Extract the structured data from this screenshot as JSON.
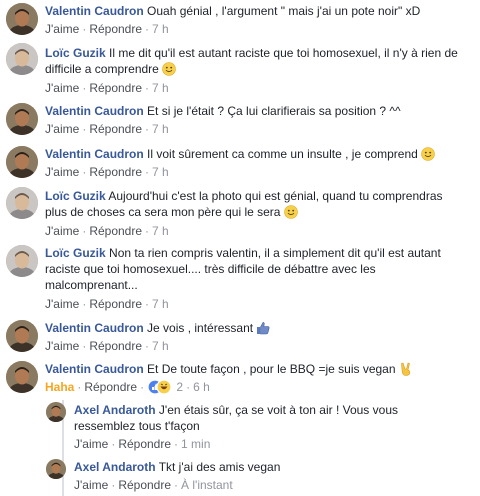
{
  "colors": {
    "name": "#385898",
    "text": "#1d2129",
    "meta": "#90949c",
    "haha": "#f5a623"
  },
  "actions": {
    "like": "J'aime",
    "reply": "Répondre"
  },
  "comments": [
    {
      "author": "Valentin Caudron",
      "text": "Ouah génial , l'argument \" mais j'ai un pote noir\" xD",
      "time": "7 h"
    },
    {
      "author": "Loïc Guzik",
      "text": "Il me dit qu'il est autant raciste que toi homosexuel, il n'y à rien de difficile a comprendre",
      "time": "7 h",
      "emoji": "smile-emoji"
    },
    {
      "author": "Valentin Caudron",
      "text": "Et si je l'était ? Ça lui clarifierais sa position ? ^^",
      "time": "7 h"
    },
    {
      "author": "Valentin Caudron",
      "text": "Il voit sûrement ca comme un insulte , je comprend",
      "time": "7 h",
      "emoji": "smile-emoji"
    },
    {
      "author": "Loïc Guzik",
      "text": "Aujourd'hui c'est la photo qui est génial, quand tu comprendras plus de choses ca sera mon père qui le sera",
      "time": "7 h",
      "emoji": "smile-emoji"
    },
    {
      "author": "Loïc Guzik",
      "text": "Non ta rien compris valentin, il a simplement dit qu'il est autant raciste que toi homosexuel.... très difficile de débattre avec les malcomprenant...",
      "time": "7 h"
    },
    {
      "author": "Valentin Caudron",
      "text": "Je vois , intéressant",
      "time": "7 h",
      "emoji": "thumbs-up-emoji"
    },
    {
      "author": "Valentin Caudron",
      "text": "Et De toute façon , pour le BBQ =je suis vegan",
      "time": "6 h",
      "emoji": "victory-hand-emoji",
      "reaction": "Haha",
      "reaction_count": "2"
    }
  ],
  "replies": [
    {
      "author": "Axel Andaroth",
      "text": "J'en étais sûr, ça se voit à ton air ! Vous vous ressemblez tous t'façon",
      "time": "1 min"
    },
    {
      "author": "Axel Andaroth",
      "text": "Tkt j'ai des amis vegan",
      "time": "À l'instant"
    }
  ]
}
